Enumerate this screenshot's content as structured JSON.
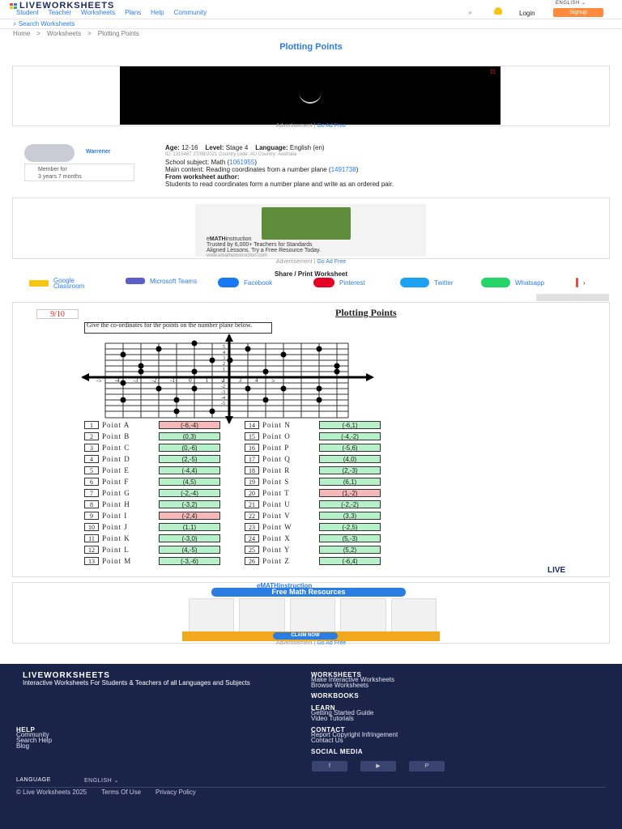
{
  "header": {
    "logo": "LIVEWORKSHEETS",
    "nav": [
      "Student",
      "Teacher",
      "Worksheets",
      "Plans",
      "Help",
      "Community"
    ],
    "language": "ENGLISH ⌄",
    "login": "Login",
    "signup": "Signup",
    "search_placeholder": "Search Worksheets"
  },
  "breadcrumb": [
    "Home",
    ">",
    "Worksheets",
    ">",
    "Plotting Points"
  ],
  "page_title": "Plotting Points",
  "ad": {
    "label": "Advertisement | ",
    "go_ad_free": "Go Ad Free"
  },
  "author": {
    "name": "Warrener",
    "member_line1": "Member for",
    "member_line2": "3 years 7 months"
  },
  "meta": {
    "age_label": "Age:",
    "age": "12-16",
    "level_label": "Level:",
    "level": "Stage 4",
    "language_label": "Language:",
    "language": "English (en)",
    "id_line": "ID: 1315487     27/08/2021     Country code: AU     Country: Australia",
    "subject_prefix": "School subject: Math (",
    "subject_id": "1061955",
    "subject_suffix": ")",
    "content_prefix": "Main content: Reading coordinates from a number plane (",
    "content_id": "1491738",
    "content_suffix": ")",
    "desc_label": "From worksheet author:",
    "desc": "Students to read coordinates form a number plane and write as an ordered pair."
  },
  "ad2": {
    "brand_e": "e",
    "brand_math": "MATH",
    "brand_rest": "instruction",
    "line1": "Trusted by 6,000+ Teachers for Standards",
    "line2": "Aligned Lessons. Try a Free Resource Today.",
    "url": "www.ematheinstruction.com"
  },
  "share": {
    "title": "Share / Print Worksheet",
    "items": [
      "Google Classroom",
      "Microsoft Teams",
      "Facebook",
      "Pinterest",
      "Twitter",
      "Whatsapp"
    ]
  },
  "worksheet": {
    "score": "9/10",
    "title": "Plotting Points",
    "instruction": "Give the co-ordinates for the points on the number plane below.",
    "x_ticks": [
      "-5",
      "-4",
      "-3",
      "-2",
      "-1",
      "0",
      "1",
      "2",
      "3",
      "4",
      "5"
    ],
    "y_ticks": [
      "5",
      "4",
      "3",
      "2",
      "1",
      "-1",
      "-2",
      "-3",
      "-4",
      "-5"
    ],
    "answers_left": [
      {
        "n": "1",
        "label": "Point A",
        "value": "(-6,-4)",
        "status": "bad"
      },
      {
        "n": "2",
        "label": "Point B",
        "value": "(0,3)",
        "status": "ok"
      },
      {
        "n": "3",
        "label": "Point C",
        "value": "(0,-6)",
        "status": "ok"
      },
      {
        "n": "4",
        "label": "Point D",
        "value": "(2,-5)",
        "status": "ok"
      },
      {
        "n": "5",
        "label": "Point E",
        "value": "(-4,4)",
        "status": "ok"
      },
      {
        "n": "6",
        "label": "Point F",
        "value": "(4,5)",
        "status": "ok"
      },
      {
        "n": "7",
        "label": "Point G",
        "value": "(-2,-4)",
        "status": "ok"
      },
      {
        "n": "8",
        "label": "Point H",
        "value": "(-3,2)",
        "status": "ok"
      },
      {
        "n": "9",
        "label": "Point I",
        "value": "(-2,4)",
        "status": "bad"
      },
      {
        "n": "10",
        "label": "Point J",
        "value": "(1,1)",
        "status": "ok"
      },
      {
        "n": "11",
        "label": "Point K",
        "value": "(-3,0)",
        "status": "ok"
      },
      {
        "n": "12",
        "label": "Point L",
        "value": "(4,-5)",
        "status": "ok"
      },
      {
        "n": "13",
        "label": "Point M",
        "value": "(-3,-6)",
        "status": "ok"
      }
    ],
    "answers_right": [
      {
        "n": "14",
        "label": "Point N",
        "value": "(-6,1)",
        "status": "ok"
      },
      {
        "n": "15",
        "label": "Point O",
        "value": "(-4,-2)",
        "status": "ok"
      },
      {
        "n": "16",
        "label": "Point P",
        "value": "(-5,6)",
        "status": "ok"
      },
      {
        "n": "17",
        "label": "Point Q",
        "value": "(4,0)",
        "status": "ok"
      },
      {
        "n": "18",
        "label": "Point R",
        "value": "(2,-3)",
        "status": "ok"
      },
      {
        "n": "19",
        "label": "Point S",
        "value": "(6,1)",
        "status": "ok"
      },
      {
        "n": "20",
        "label": "Point T",
        "value": "(1,-2)",
        "status": "bad"
      },
      {
        "n": "21",
        "label": "Point U",
        "value": "(-2,-2)",
        "status": "ok"
      },
      {
        "n": "22",
        "label": "Point V",
        "value": "(3,3)",
        "status": "ok"
      },
      {
        "n": "23",
        "label": "Point W",
        "value": "(-2,5)",
        "status": "ok"
      },
      {
        "n": "24",
        "label": "Point X",
        "value": "(5,-3)",
        "status": "ok"
      },
      {
        "n": "25",
        "label": "Point Y",
        "value": "(5,2)",
        "status": "ok"
      },
      {
        "n": "26",
        "label": "Point Z",
        "value": "(-6,4)",
        "status": "ok"
      }
    ],
    "logo": "LIVE"
  },
  "ad3": {
    "brand": "eMATHinstruction",
    "headline": "Free Math Resources",
    "cta": "CLAIM NOW"
  },
  "footer": {
    "logo": "LIVEWORKSHEETS",
    "tagline": "Interactive Worksheets For Students & Teachers of all Languages and Subjects",
    "worksheets_h": "WORKSHEETS",
    "worksheets_links": [
      "Make Interactive Worksheets",
      "Browse Worksheets"
    ],
    "workbooks_h": "WORKBOOKS",
    "learn_h": "LEARN",
    "learn_links": [
      "Getting Started Guide",
      "Video Tutorials"
    ],
    "help_h": "HELP",
    "help_links": [
      "Community",
      "Search Help",
      "Blog"
    ],
    "contact_h": "CONTACT",
    "contact_links": [
      "Report Copyright Infringement",
      "Contact Us"
    ],
    "social_h": "SOCIAL MEDIA",
    "language_label": "LANGUAGE",
    "language_value": "ENGLISH ⌄",
    "copyright": "© Live Worksheets 2025",
    "terms": "Terms Of Use",
    "privacy": "Privacy Policy"
  },
  "colors": {
    "accent": "#2b7de1",
    "signup": "#ff8a3d",
    "footer": "#1a2449",
    "correct": "#b6f1c9",
    "wrong": "#f5b7b7"
  }
}
